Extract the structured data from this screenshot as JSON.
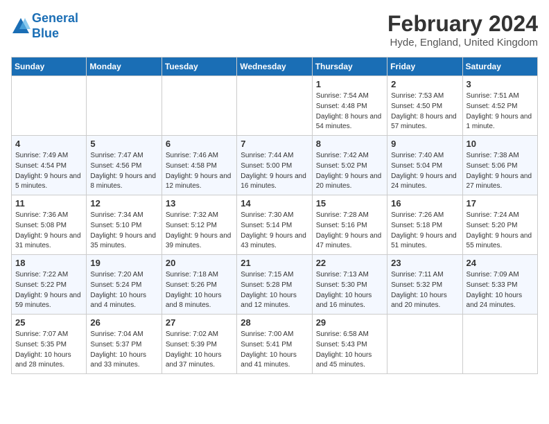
{
  "header": {
    "logo_line1": "General",
    "logo_line2": "Blue",
    "month_title": "February 2024",
    "location": "Hyde, England, United Kingdom"
  },
  "days_of_week": [
    "Sunday",
    "Monday",
    "Tuesday",
    "Wednesday",
    "Thursday",
    "Friday",
    "Saturday"
  ],
  "weeks": [
    [
      {
        "day": "",
        "content": ""
      },
      {
        "day": "",
        "content": ""
      },
      {
        "day": "",
        "content": ""
      },
      {
        "day": "",
        "content": ""
      },
      {
        "day": "1",
        "content": "Sunrise: 7:54 AM\nSunset: 4:48 PM\nDaylight: 8 hours and 54 minutes."
      },
      {
        "day": "2",
        "content": "Sunrise: 7:53 AM\nSunset: 4:50 PM\nDaylight: 8 hours and 57 minutes."
      },
      {
        "day": "3",
        "content": "Sunrise: 7:51 AM\nSunset: 4:52 PM\nDaylight: 9 hours and 1 minute."
      }
    ],
    [
      {
        "day": "4",
        "content": "Sunrise: 7:49 AM\nSunset: 4:54 PM\nDaylight: 9 hours and 5 minutes."
      },
      {
        "day": "5",
        "content": "Sunrise: 7:47 AM\nSunset: 4:56 PM\nDaylight: 9 hours and 8 minutes."
      },
      {
        "day": "6",
        "content": "Sunrise: 7:46 AM\nSunset: 4:58 PM\nDaylight: 9 hours and 12 minutes."
      },
      {
        "day": "7",
        "content": "Sunrise: 7:44 AM\nSunset: 5:00 PM\nDaylight: 9 hours and 16 minutes."
      },
      {
        "day": "8",
        "content": "Sunrise: 7:42 AM\nSunset: 5:02 PM\nDaylight: 9 hours and 20 minutes."
      },
      {
        "day": "9",
        "content": "Sunrise: 7:40 AM\nSunset: 5:04 PM\nDaylight: 9 hours and 24 minutes."
      },
      {
        "day": "10",
        "content": "Sunrise: 7:38 AM\nSunset: 5:06 PM\nDaylight: 9 hours and 27 minutes."
      }
    ],
    [
      {
        "day": "11",
        "content": "Sunrise: 7:36 AM\nSunset: 5:08 PM\nDaylight: 9 hours and 31 minutes."
      },
      {
        "day": "12",
        "content": "Sunrise: 7:34 AM\nSunset: 5:10 PM\nDaylight: 9 hours and 35 minutes."
      },
      {
        "day": "13",
        "content": "Sunrise: 7:32 AM\nSunset: 5:12 PM\nDaylight: 9 hours and 39 minutes."
      },
      {
        "day": "14",
        "content": "Sunrise: 7:30 AM\nSunset: 5:14 PM\nDaylight: 9 hours and 43 minutes."
      },
      {
        "day": "15",
        "content": "Sunrise: 7:28 AM\nSunset: 5:16 PM\nDaylight: 9 hours and 47 minutes."
      },
      {
        "day": "16",
        "content": "Sunrise: 7:26 AM\nSunset: 5:18 PM\nDaylight: 9 hours and 51 minutes."
      },
      {
        "day": "17",
        "content": "Sunrise: 7:24 AM\nSunset: 5:20 PM\nDaylight: 9 hours and 55 minutes."
      }
    ],
    [
      {
        "day": "18",
        "content": "Sunrise: 7:22 AM\nSunset: 5:22 PM\nDaylight: 9 hours and 59 minutes."
      },
      {
        "day": "19",
        "content": "Sunrise: 7:20 AM\nSunset: 5:24 PM\nDaylight: 10 hours and 4 minutes."
      },
      {
        "day": "20",
        "content": "Sunrise: 7:18 AM\nSunset: 5:26 PM\nDaylight: 10 hours and 8 minutes."
      },
      {
        "day": "21",
        "content": "Sunrise: 7:15 AM\nSunset: 5:28 PM\nDaylight: 10 hours and 12 minutes."
      },
      {
        "day": "22",
        "content": "Sunrise: 7:13 AM\nSunset: 5:30 PM\nDaylight: 10 hours and 16 minutes."
      },
      {
        "day": "23",
        "content": "Sunrise: 7:11 AM\nSunset: 5:32 PM\nDaylight: 10 hours and 20 minutes."
      },
      {
        "day": "24",
        "content": "Sunrise: 7:09 AM\nSunset: 5:33 PM\nDaylight: 10 hours and 24 minutes."
      }
    ],
    [
      {
        "day": "25",
        "content": "Sunrise: 7:07 AM\nSunset: 5:35 PM\nDaylight: 10 hours and 28 minutes."
      },
      {
        "day": "26",
        "content": "Sunrise: 7:04 AM\nSunset: 5:37 PM\nDaylight: 10 hours and 33 minutes."
      },
      {
        "day": "27",
        "content": "Sunrise: 7:02 AM\nSunset: 5:39 PM\nDaylight: 10 hours and 37 minutes."
      },
      {
        "day": "28",
        "content": "Sunrise: 7:00 AM\nSunset: 5:41 PM\nDaylight: 10 hours and 41 minutes."
      },
      {
        "day": "29",
        "content": "Sunrise: 6:58 AM\nSunset: 5:43 PM\nDaylight: 10 hours and 45 minutes."
      },
      {
        "day": "",
        "content": ""
      },
      {
        "day": "",
        "content": ""
      }
    ]
  ]
}
